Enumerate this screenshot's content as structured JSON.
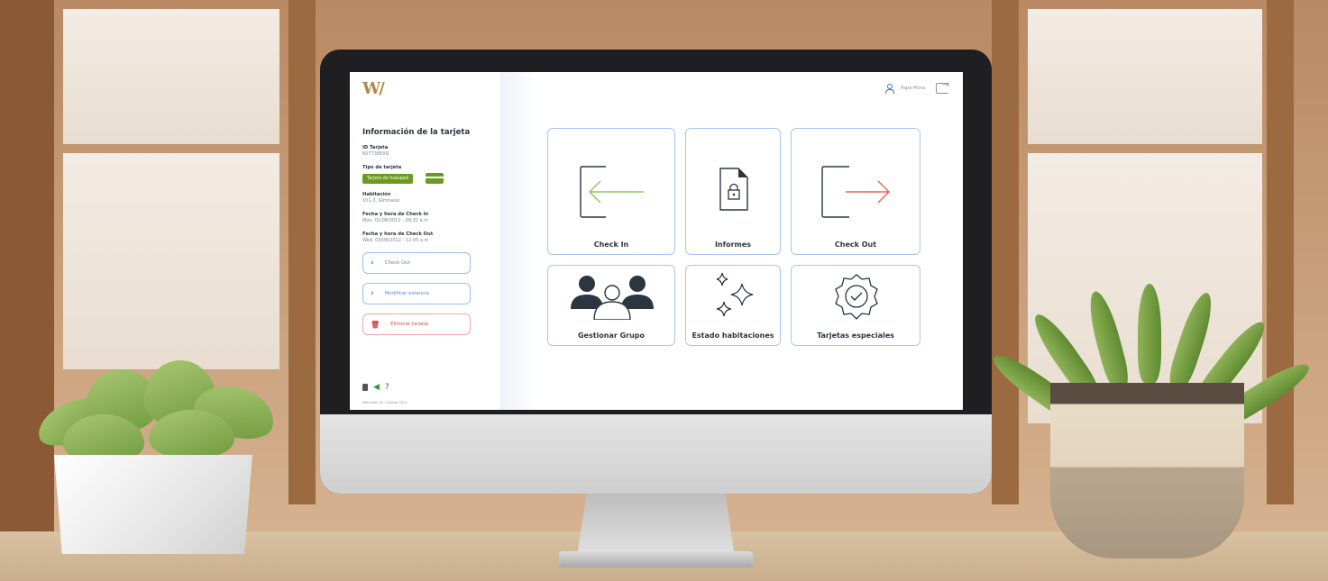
{
  "app": {
    "logo": "W/",
    "user_name": "Pepe Mora"
  },
  "sidebar": {
    "title": "Información de la tarjeta",
    "fields": [
      {
        "label": "ID Tarjeta",
        "value": "607738EXD"
      },
      {
        "label": "Tipo de tarjeta",
        "value": "Tarjeta de huésped"
      },
      {
        "label": "Habitación",
        "value": "101-3, Gimnasio"
      },
      {
        "label": "Fecha y hora de Check In",
        "value": "Mon, 01/08/2012 - 09:32 a.m"
      },
      {
        "label": "Fecha y hora de Check Out",
        "value": "Wed, 03/08/2012 - 12:05 a.m"
      }
    ],
    "buttons": [
      {
        "label": "Check Out"
      },
      {
        "label": "Modificar estancia"
      },
      {
        "label": "Eliminar tarjeta"
      }
    ],
    "footer_date": "Miércoles 28, Octubre 2021"
  },
  "tiles": [
    {
      "label": "Check In",
      "icon": "check-in-icon"
    },
    {
      "label": "Informes",
      "icon": "locked-file-icon"
    },
    {
      "label": "Check Out",
      "icon": "check-out-icon"
    },
    {
      "label": "Gestionar Grupo",
      "icon": "group-icon"
    },
    {
      "label": "Estado habitaciones",
      "icon": "sparkles-icon"
    },
    {
      "label": "Tarjetas especiales",
      "icon": "verified-badge-icon"
    }
  ],
  "colors": {
    "accent_blue": "#3a6fc2",
    "tile_border": "#a9c4ef",
    "card_green": "#6b9b1e",
    "danger_red": "#d24a4a",
    "logo_gold": "#b3864a",
    "check_in_arrow": "#8fc25a",
    "check_out_arrow": "#e7615a"
  }
}
